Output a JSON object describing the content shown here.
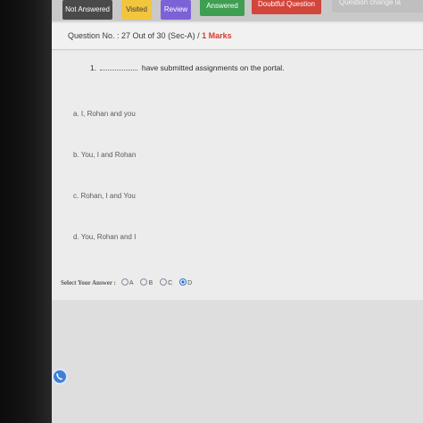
{
  "status_bar": {
    "not_answered": "Not Answered",
    "visited": "Visited",
    "review": "Review",
    "answered": "Answered",
    "doubtful": "Doubtful Question",
    "question_change": "Question change la"
  },
  "question": {
    "header_prefix": "Question No. : 27 Out of 30 (Sec-A) /",
    "marks": "1 Marks",
    "number": "1.",
    "stem_text": "have submitted assignments on the portal."
  },
  "options": [
    {
      "label": "a. I, Rohan and you"
    },
    {
      "label": "b. You, I and Rohan"
    },
    {
      "label": "c. Rohan, I and You"
    },
    {
      "label": "d. You, Rohan and I"
    }
  ],
  "answer": {
    "prompt": "Select Your Answer :",
    "choices": [
      "A",
      "B",
      "C",
      "D"
    ],
    "selected": "D"
  },
  "colors": {
    "not_answered": "#4a4a4a",
    "visited": "#f2c53d",
    "review": "#7c62d6",
    "answered": "#3e9e52",
    "doubtful": "#d2453b",
    "accent": "#2c6cd6"
  }
}
